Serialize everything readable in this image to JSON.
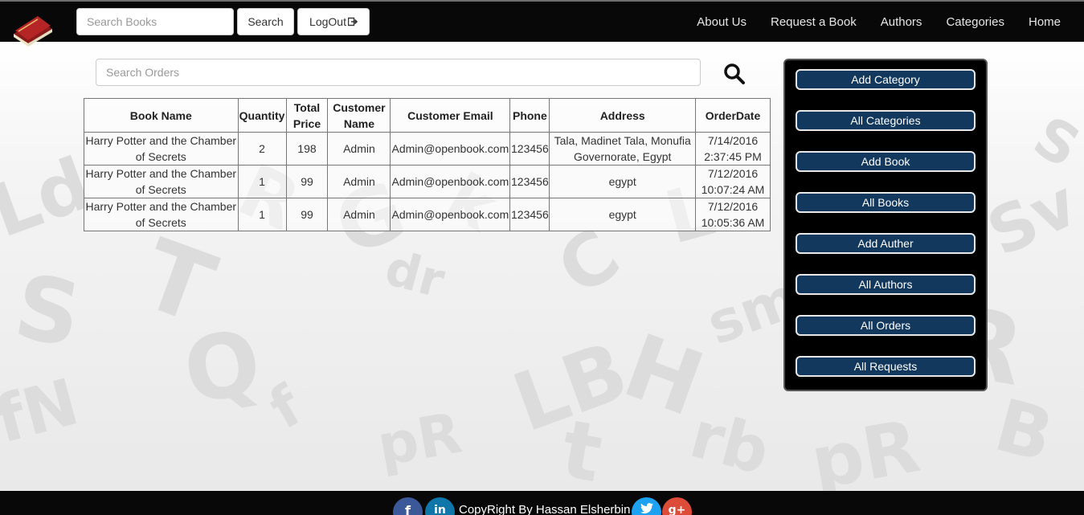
{
  "navbar": {
    "search_placeholder": "Search Books",
    "search_button": "Search",
    "logout_button": "LogOut",
    "links": [
      "About Us",
      "Request a Book",
      "Authors",
      "Categories",
      "Home"
    ]
  },
  "orders": {
    "search_placeholder": "Search Orders",
    "columns": [
      "Book Name",
      "Quantity",
      "Total Price",
      "Customer Name",
      "Customer Email",
      "Phone",
      "Address",
      "OrderDate"
    ],
    "rows": [
      [
        "Harry Potter and the Chamber of Secrets",
        "2",
        "198",
        "Admin",
        "Admin@openbook.com",
        "123456",
        "Tala, Madinet Tala, Monufia Governorate, Egypt",
        "7/14/2016 2:37:45 PM"
      ],
      [
        "Harry Potter and the Chamber of Secrets",
        "1",
        "99",
        "Admin",
        "Admin@openbook.com",
        "123456",
        "egypt",
        "7/12/2016 10:07:24 AM"
      ],
      [
        "Harry Potter and the Chamber of Secrets",
        "1",
        "99",
        "Admin",
        "Admin@openbook.com",
        "123456",
        "egypt",
        "7/12/2016 10:05:36 AM"
      ]
    ]
  },
  "admin_panel": {
    "buttons": [
      "Add Category",
      "All Categories",
      "Add Book",
      "All Books",
      "Add Auther",
      "All Authors",
      "All Orders",
      "All Requests"
    ]
  },
  "footer": {
    "copyright": "CopyRight By Hassan Elsherbin"
  },
  "colors": {
    "navbar_bg": "#080808",
    "panel_button_bg": "#13385e",
    "facebook": "#3b5998",
    "linkedin": "#0e76a8",
    "twitter": "#1da1f2",
    "google_plus": "#dd4b39"
  },
  "icons": [
    "book-logo-icon",
    "logout-icon",
    "search-icon",
    "facebook-icon",
    "linkedin-icon",
    "twitter-icon",
    "google-plus-icon"
  ]
}
